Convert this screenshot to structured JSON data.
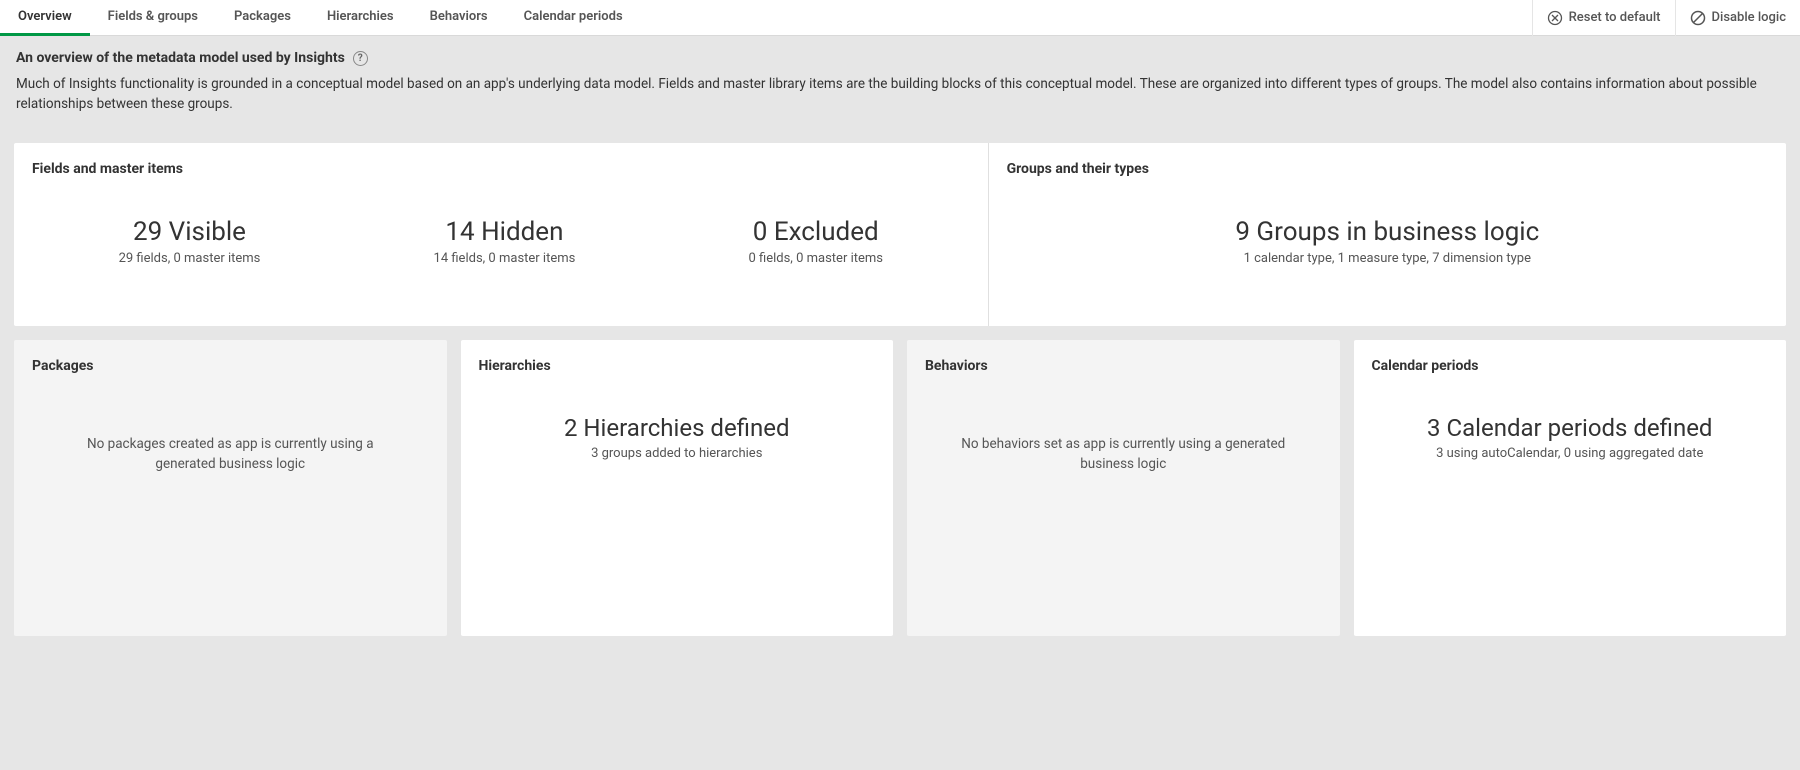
{
  "tabs": {
    "overview": "Overview",
    "fields_groups": "Fields & groups",
    "packages": "Packages",
    "hierarchies": "Hierarchies",
    "behaviors": "Behaviors",
    "calendar_periods": "Calendar periods"
  },
  "toolbar": {
    "reset": "Reset to default",
    "disable": "Disable logic"
  },
  "intro": {
    "title": "An overview of the metadata model used by Insights",
    "desc": "Much of Insights functionality is grounded in a conceptual model based on an app's underlying data model. Fields and master library items are the building blocks of this conceptual model. These are organized into different types of groups. The model also contains information about possible relationships between these groups.",
    "help": "?"
  },
  "cards": {
    "fields": {
      "title": "Fields and master items",
      "visible": {
        "big": "29 Visible",
        "sub": "29 fields, 0 master items"
      },
      "hidden": {
        "big": "14 Hidden",
        "sub": "14 fields, 0 master items"
      },
      "excluded": {
        "big": "0 Excluded",
        "sub": "0 fields, 0 master items"
      }
    },
    "groups": {
      "title": "Groups and their types",
      "big": "9 Groups in business logic",
      "sub": "1 calendar type, 1 measure type, 7 dimension type"
    },
    "packages": {
      "title": "Packages",
      "empty": "No packages created as app is currently using a generated business logic"
    },
    "hierarchies": {
      "title": "Hierarchies",
      "big": "2 Hierarchies defined",
      "sub": "3 groups added to hierarchies"
    },
    "behaviors": {
      "title": "Behaviors",
      "empty": "No behaviors set as app is currently using a generated business logic"
    },
    "calendar": {
      "title": "Calendar periods",
      "big": "3 Calendar periods defined",
      "sub": "3 using autoCalendar, 0 using aggregated date"
    }
  }
}
